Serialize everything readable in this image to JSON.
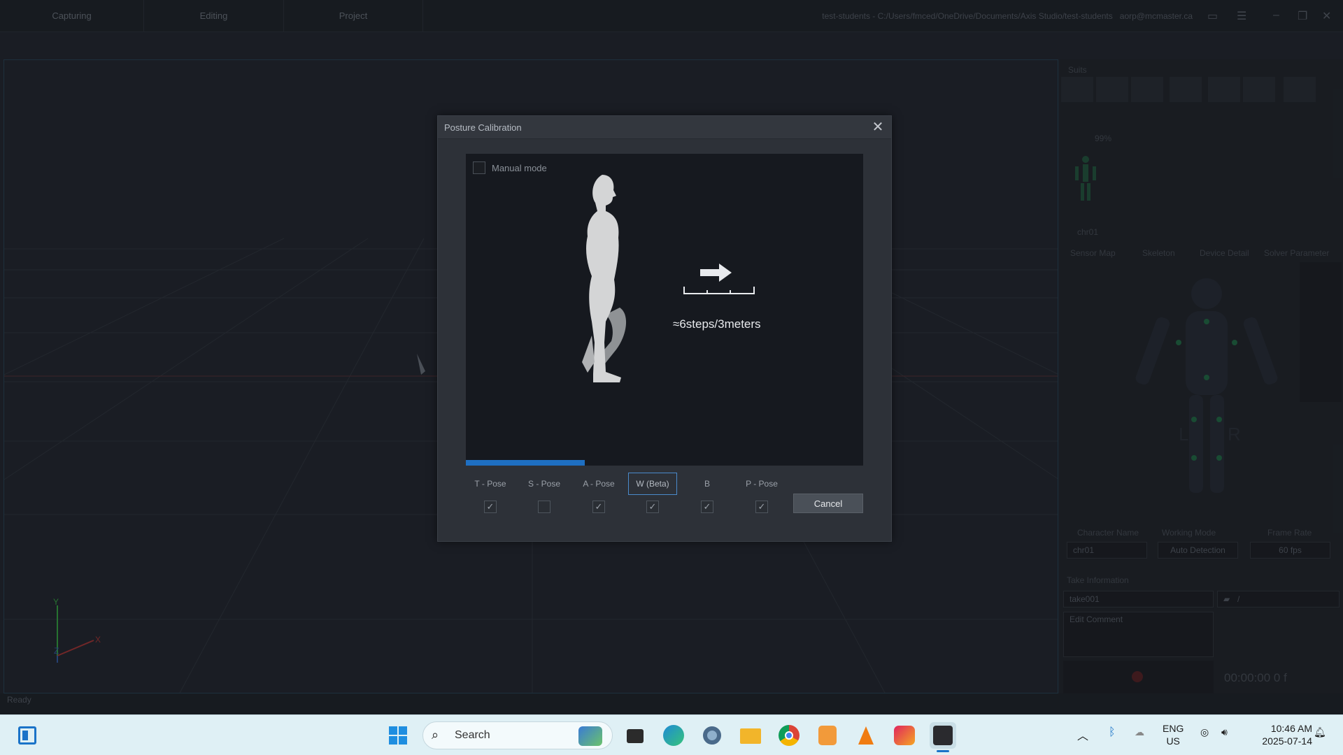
{
  "app": {
    "tabs": [
      "Capturing",
      "Editing",
      "Project"
    ],
    "path": "test-students - C:/Users/fmced/OneDrive/Documents/Axis Studio/test-students",
    "user": "aorp@mcmaster.ca"
  },
  "viewport": {
    "axis_y": "Y",
    "axis_x": "X",
    "axis_z": "Z"
  },
  "right_panel": {
    "title": "Suits",
    "battery": "99%",
    "char_label": "chr01",
    "subtabs": [
      "Sensor Map",
      "Skeleton",
      "Device Detail",
      "Solver Parameter"
    ],
    "left_label": "L",
    "right_label": "R",
    "fields_labels": [
      "Character Name",
      "Working Mode",
      "Frame Rate"
    ],
    "fields_values": [
      "chr01",
      "Auto Detection",
      "60 fps"
    ],
    "take_header": "Take Information",
    "take_name": "take001",
    "folder_path": "/",
    "comment_placeholder": "Edit Comment",
    "timecode": "00:00:00 0 f"
  },
  "status": "Ready",
  "dialog": {
    "title": "Posture Calibration",
    "manual_mode": "Manual mode",
    "steps_text": "≈6steps/3meters",
    "progress": 0.3,
    "poses": [
      {
        "label": "T - Pose",
        "checked": true
      },
      {
        "label": "S - Pose",
        "checked": false
      },
      {
        "label": "A - Pose",
        "checked": true
      },
      {
        "label": "W (Beta)",
        "checked": true,
        "selected": true
      },
      {
        "label": "B",
        "checked": true
      },
      {
        "label": "P - Pose",
        "checked": true
      }
    ],
    "cancel": "Cancel"
  },
  "taskbar": {
    "search_label": "Search",
    "lang_line1": "ENG",
    "lang_line2": "US",
    "time": "10:46 AM",
    "date": "2025-07-14"
  },
  "colors": {
    "accent": "#1e6fc2",
    "dialog_bg": "#2d3138",
    "taskbar": "#dff0f5"
  }
}
